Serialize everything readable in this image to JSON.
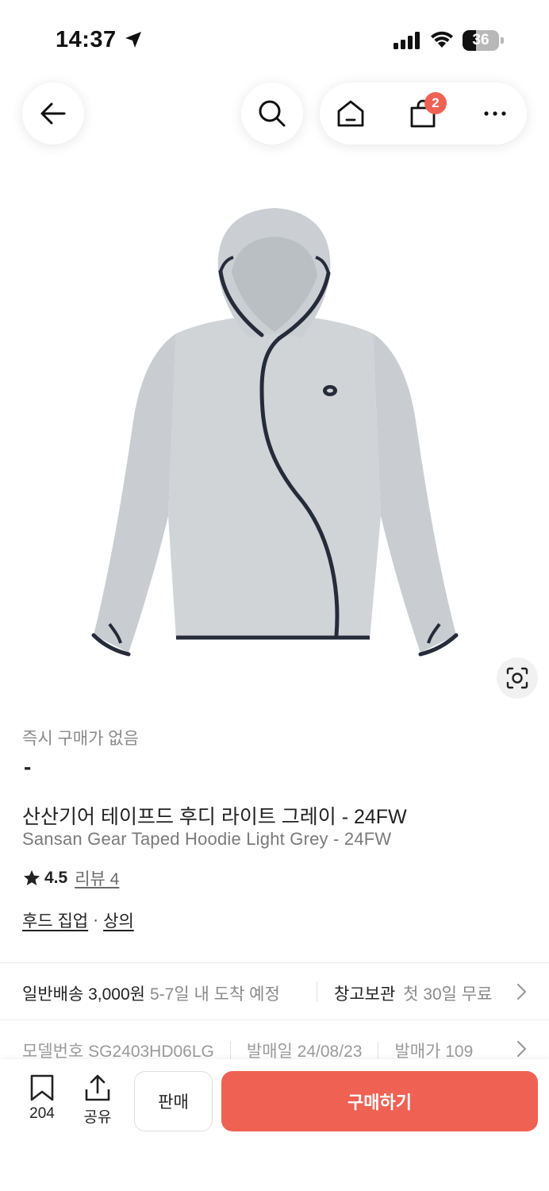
{
  "status_bar": {
    "time": "14:37",
    "battery_percent": "36",
    "battery_level": 0.36
  },
  "nav": {
    "cart_count": "2",
    "icons": [
      "back-arrow-icon",
      "search-icon",
      "home-icon",
      "shopping-bag-icon",
      "more-icon"
    ]
  },
  "product": {
    "image_description_icon": "hoodie-image",
    "price_label": "즉시 구매가 없음",
    "price_value": "-",
    "title_ko": "산산기어 테이프드 후디 라이트 그레이 - 24FW",
    "title_en": "Sansan Gear Taped Hoodie Light Grey - 24FW",
    "rating": "4.5",
    "review_label": "리뷰 4",
    "categories": [
      "후드 집업",
      "상의"
    ],
    "category_separator": "·"
  },
  "shipping": {
    "method": "일반배송 3,000원",
    "eta": "5-7일 내 도착 예정",
    "storage_label": "창고보관",
    "storage_note": "첫 30일 무료"
  },
  "meta": {
    "model_number": "모델번호 SG2403HD06LG",
    "release_date": "발매일 24/08/23",
    "release_price": "발매가 109"
  },
  "bottom_bar": {
    "bookmark_count": "204",
    "share_label": "공유",
    "sell_label": "판매",
    "buy_label": "구매하기"
  },
  "colors": {
    "accent": "#ef6253",
    "text_primary": "#222222",
    "text_secondary": "#8a8a8a",
    "hoodie_grey": "#cfd3d6",
    "tape_navy": "#262b3a"
  }
}
